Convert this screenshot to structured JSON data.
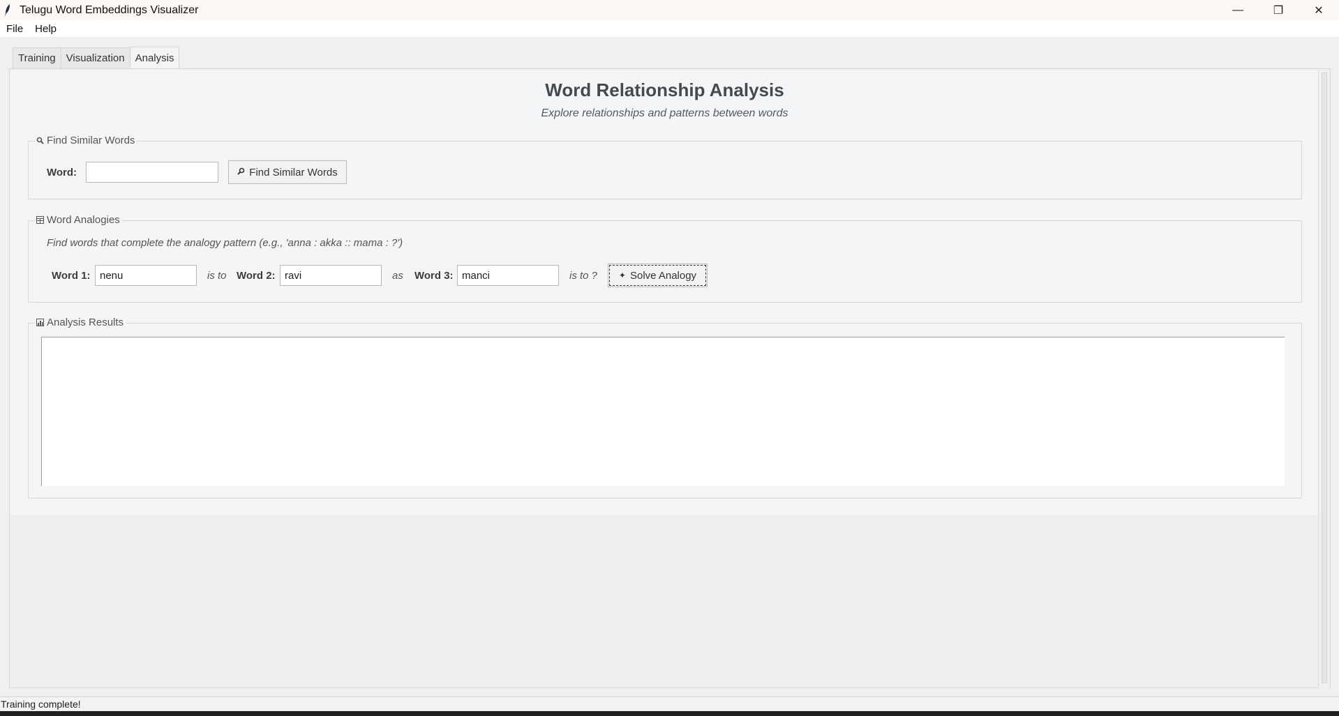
{
  "window": {
    "title": "Telugu Word Embeddings Visualizer",
    "controls": {
      "minimize": "—",
      "restore": "❐",
      "close": "✕"
    }
  },
  "menu": {
    "items": [
      "File",
      "Help"
    ]
  },
  "tabs": {
    "items": [
      "Training",
      "Visualization",
      "Analysis"
    ],
    "active": "Analysis"
  },
  "analysis": {
    "title": "Word Relationship Analysis",
    "subtitle": "Explore relationships and patterns between words",
    "similar": {
      "legend": "Find Similar Words",
      "legend_icon": "magnifier-icon",
      "word_label": "Word:",
      "word_value": "",
      "button_label": "Find Similar Words",
      "button_icon": "magnifier-icon"
    },
    "analogies": {
      "legend": "Word Analogies",
      "legend_icon": "table-icon",
      "description": "Find words that complete the analogy pattern (e.g., 'anna : akka :: mama : ?')",
      "word1_label": "Word 1:",
      "word1_value": "nenu",
      "is_to": "is to",
      "word2_label": "Word 2:",
      "word2_value": "ravi",
      "as": "as",
      "word3_label": "Word 3:",
      "word3_value": "manci",
      "is_to_q": "is to ?",
      "button_label": "Solve Analogy",
      "button_icon": "sparkle-icon"
    },
    "results": {
      "legend": "Analysis Results",
      "legend_icon": "chart-icon",
      "text": ""
    }
  },
  "status": {
    "text": "Training complete!"
  },
  "colors": {
    "title_text": "#444a52",
    "panel_bg": "#f4f5f6",
    "window_bg": "#f0f0f0"
  }
}
